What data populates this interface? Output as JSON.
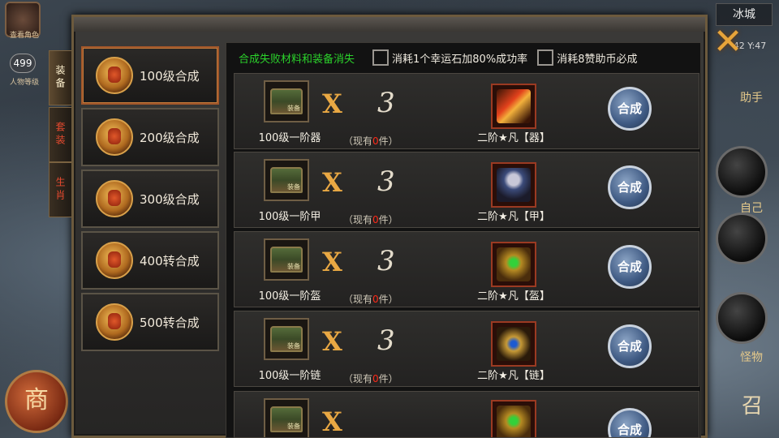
{
  "hud": {
    "city_name": "冰城",
    "coords_text": "42 Y:47",
    "level_badge": "499",
    "top_left_label_1": "查看角色",
    "top_left_label_2": "人物等级",
    "shop_label": "商",
    "right_label_1": "助手",
    "right_label_2": "自己",
    "right_label_3": "怪物",
    "right_label_4": "召",
    "close_icon": "✕"
  },
  "side_tabs": [
    {
      "label": "装备",
      "state": "active"
    },
    {
      "label": "套装",
      "state": "inactive"
    },
    {
      "label": "生肖",
      "state": "inactive"
    }
  ],
  "level_list": [
    {
      "label": "100级合成",
      "active": true
    },
    {
      "label": "200级合成",
      "active": false
    },
    {
      "label": "300级合成",
      "active": false
    },
    {
      "label": "400转合成",
      "active": false
    },
    {
      "label": "500转合成",
      "active": false
    }
  ],
  "info_bar": {
    "warning": "合成失败材料和装备消失",
    "option_1": "消耗1个幸运石加80%成功率",
    "option_2": "消耗8赞助币必成"
  },
  "recipes": [
    {
      "material": "100级一阶器",
      "times": "X",
      "qty": "3",
      "owned_prefix": "（现有",
      "owned_num": "0",
      "owned_suffix": "件）",
      "result": "二阶★凡【器】",
      "art": "weapon",
      "button": "合成"
    },
    {
      "material": "100级一阶甲",
      "times": "X",
      "qty": "3",
      "owned_prefix": "（现有",
      "owned_num": "0",
      "owned_suffix": "件）",
      "result": "二阶★凡【甲】",
      "art": "armor",
      "button": "合成"
    },
    {
      "material": "100级一阶盔",
      "times": "X",
      "qty": "3",
      "owned_prefix": "（现有",
      "owned_num": "0",
      "owned_suffix": "件）",
      "result": "二阶★凡【盔】",
      "art": "helm",
      "button": "合成"
    },
    {
      "material": "100级一阶链",
      "times": "X",
      "qty": "3",
      "owned_prefix": "（现有",
      "owned_num": "0",
      "owned_suffix": "件）",
      "result": "二阶★凡【链】",
      "art": "chain",
      "button": "合成"
    },
    {
      "material": "",
      "times": "X",
      "qty": "",
      "owned_prefix": "",
      "owned_num": "",
      "owned_suffix": "",
      "result": "",
      "art": "helm",
      "button": "合成"
    }
  ],
  "colors": {
    "warning_green": "#2bd12b",
    "owned_red": "#ff2a1a",
    "accent_gold": "#e9a843",
    "panel_border": "#6c5a3d"
  }
}
